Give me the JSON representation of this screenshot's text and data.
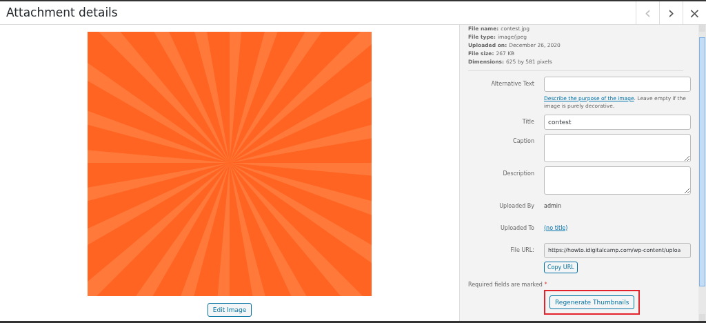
{
  "header": {
    "title": "Attachment details",
    "nav": [
      {
        "symbol": "‹",
        "disabled": true
      },
      {
        "symbol": "›",
        "disabled": false
      }
    ],
    "close": "×"
  },
  "preview": {
    "edit_button": "Edit Image"
  },
  "file_info": [
    {
      "label": "File name:",
      "value": "contest.jpg"
    },
    {
      "label": "File type:",
      "value": "image/jpeg"
    },
    {
      "label": "Uploaded on:",
      "value": "December 26, 2020"
    },
    {
      "label": "File size:",
      "value": "267 KB"
    },
    {
      "label": "Dimensions:",
      "value": "625 by 581 pixels"
    }
  ],
  "fields": [
    {
      "kind": "input",
      "label": "Alternative Text",
      "help_link": "Describe the purpose of the image",
      "help_text": ". Leave empty if the image is purely decorative."
    },
    {
      "kind": "input",
      "label": "Title",
      "value": "contest"
    },
    {
      "kind": "textarea",
      "label": "Caption"
    },
    {
      "kind": "textarea",
      "label": "Description"
    },
    {
      "kind": "text",
      "label": "Uploaded By",
      "value": "admin"
    },
    {
      "kind": "link",
      "label": "Uploaded To",
      "value": "(no title)"
    },
    {
      "kind": "url",
      "label": "File URL:",
      "value": "https://howto.idigitalcamp.com/wp-content/uploa",
      "button": "Copy URL"
    }
  ],
  "required_note": {
    "text": "Required fields are marked",
    "mark": "*"
  },
  "regenerate_button": {
    "label": "Regenerate Thumbnails",
    "highlighted": true
  }
}
